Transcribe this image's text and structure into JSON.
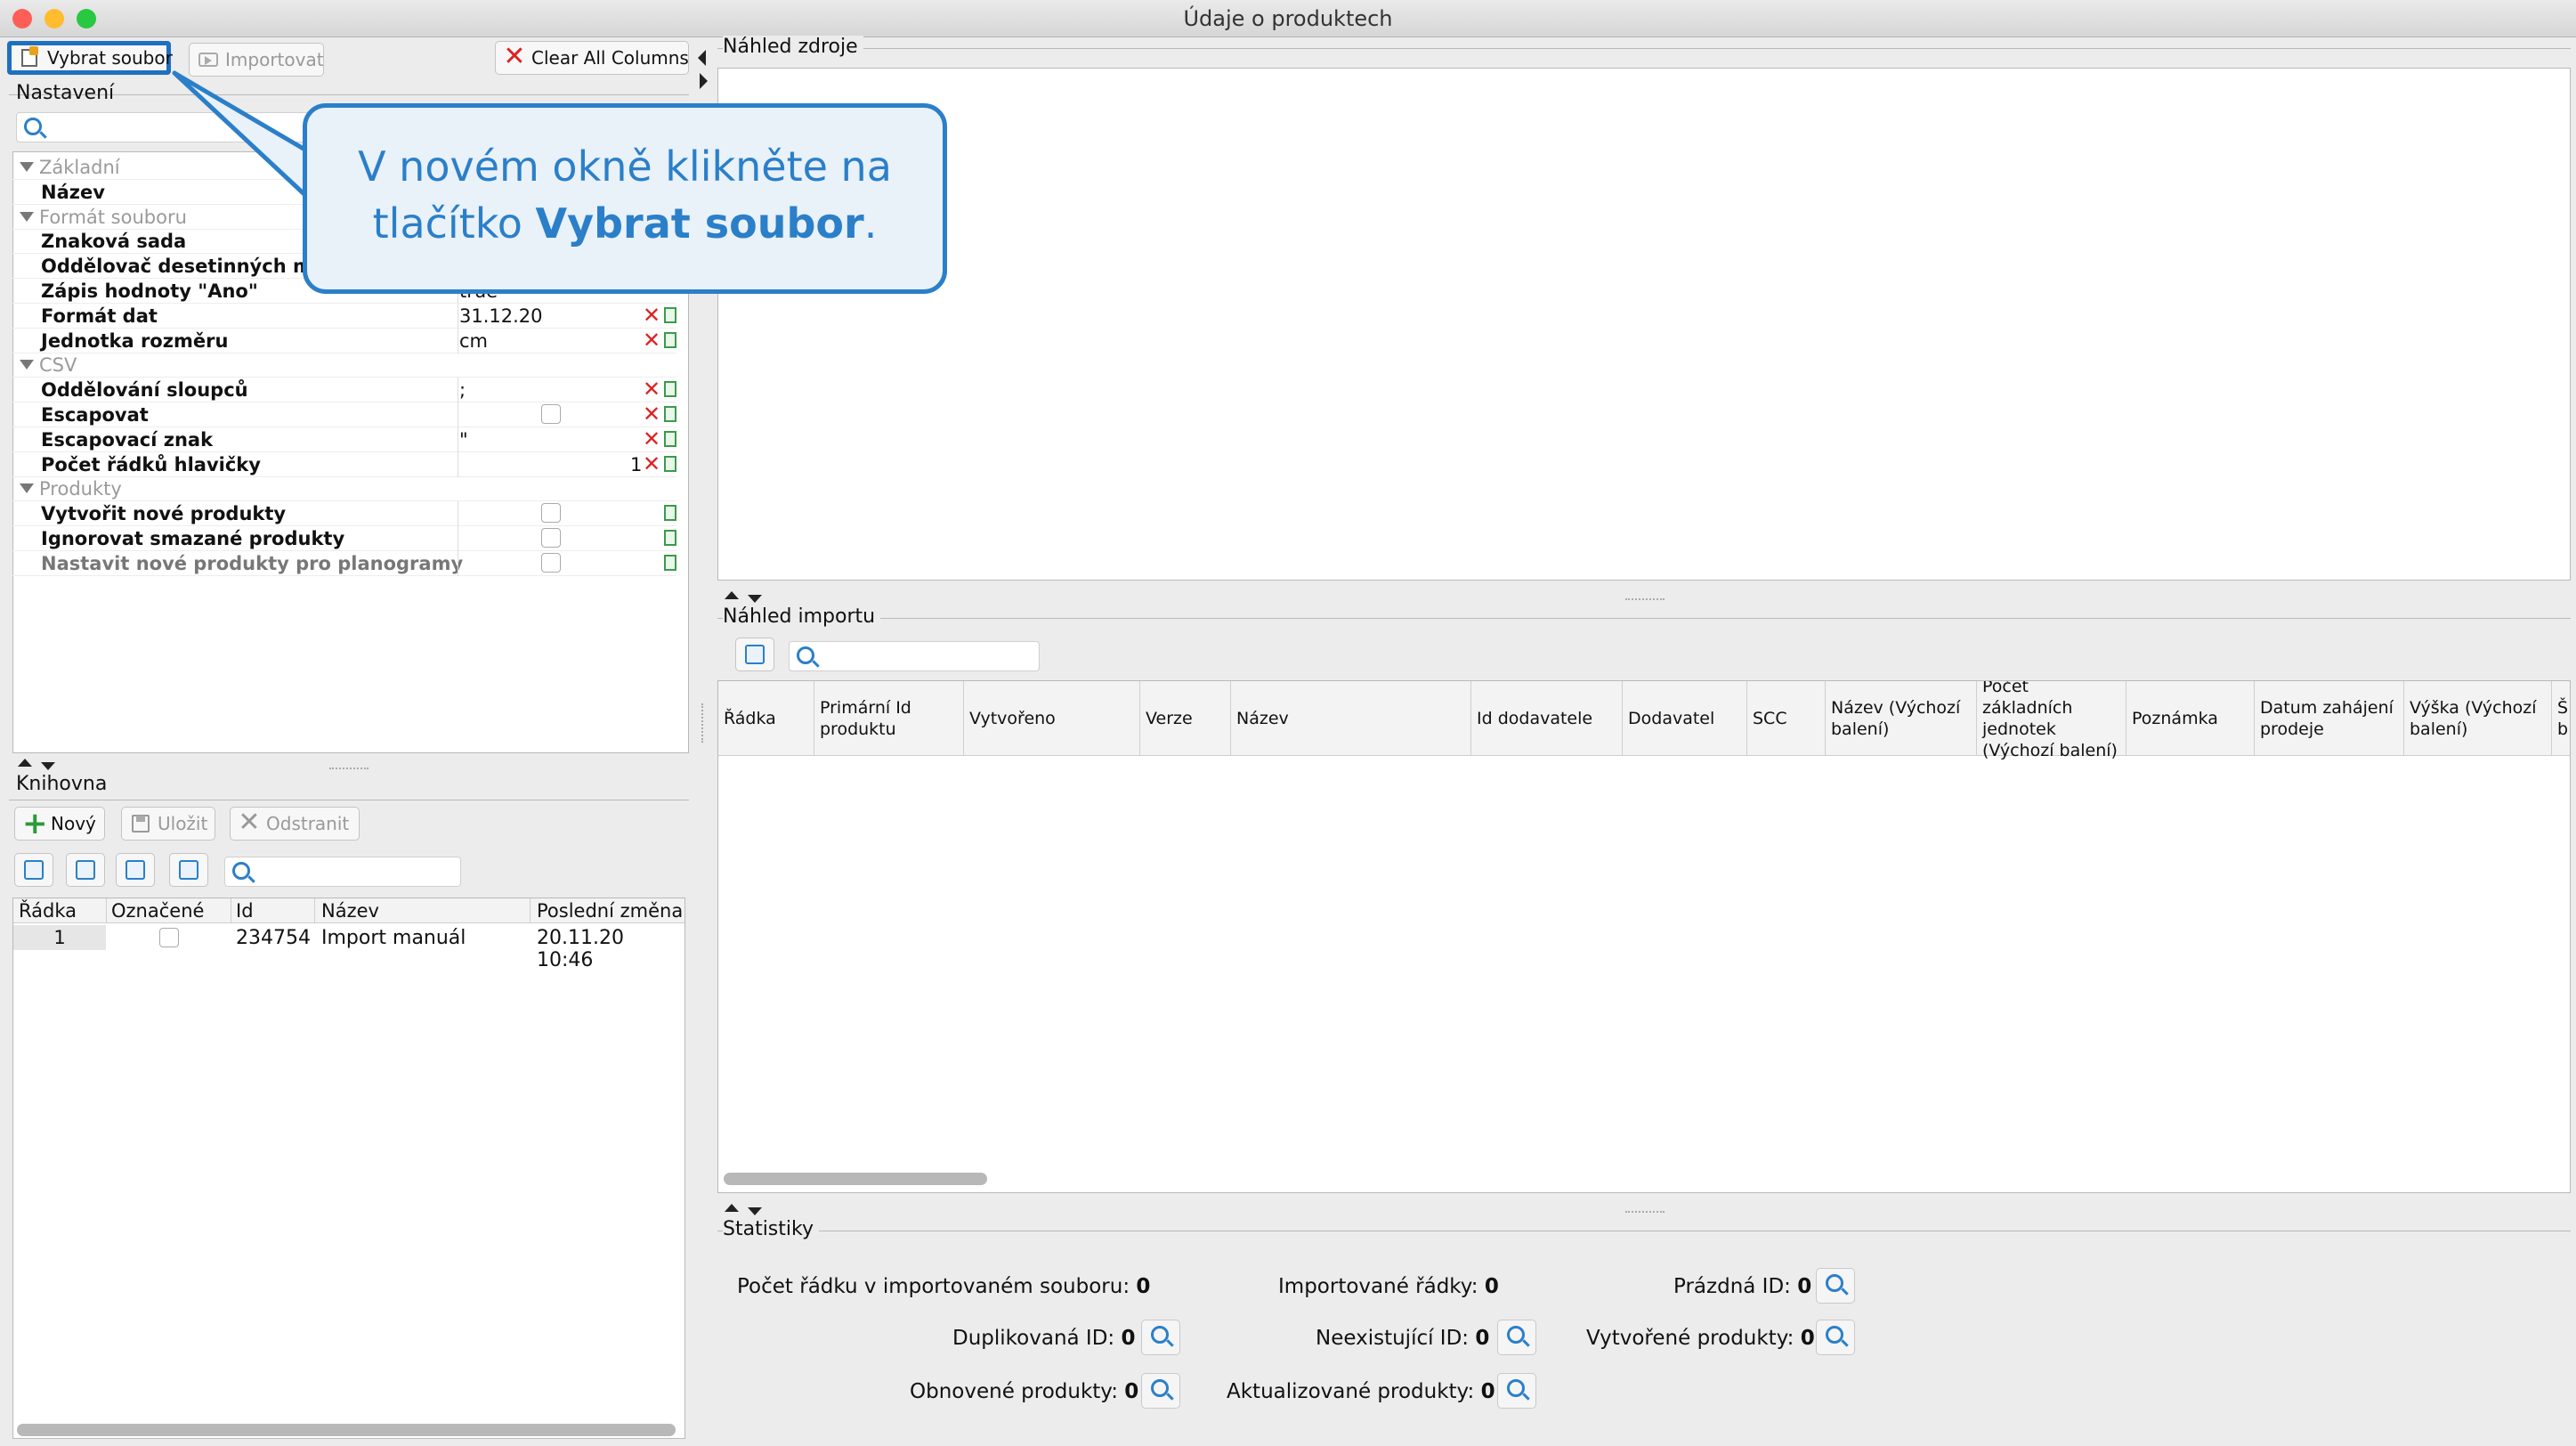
{
  "window": {
    "title": "Údaje o produktech"
  },
  "toolbar": {
    "select_file": "Vybrat soubor",
    "import": "Importovat",
    "clear_all": "Clear All Columns"
  },
  "settings": {
    "label": "Nastavení",
    "rows": [
      {
        "type": "group",
        "label": "Základní"
      },
      {
        "type": "prop",
        "label": "Název",
        "value": ""
      },
      {
        "type": "group",
        "label": "Formát souboru"
      },
      {
        "type": "prop",
        "label": "Znaková sada",
        "value": ""
      },
      {
        "type": "prop",
        "label": "Oddělovač desetinných míst",
        "value": ""
      },
      {
        "type": "prop",
        "label": "Zápis hodnoty \"Ano\"",
        "value": "true"
      },
      {
        "type": "prop",
        "label": "Formát dat",
        "value": "31.12.20"
      },
      {
        "type": "prop",
        "label": "Jednotka rozměru",
        "value": "cm"
      },
      {
        "type": "group",
        "label": "CSV"
      },
      {
        "type": "prop",
        "label": "Oddělování sloupců",
        "value": ";"
      },
      {
        "type": "prop",
        "label": "Escapovat",
        "value": ""
      },
      {
        "type": "prop",
        "label": "Escapovací znak",
        "value": "\""
      },
      {
        "type": "prop",
        "label": "Počet řádků hlavičky",
        "value": "1"
      },
      {
        "type": "group",
        "label": "Produkty"
      },
      {
        "type": "prop",
        "label": "Vytvořit nové produkty",
        "value": ""
      },
      {
        "type": "prop",
        "label": "Ignorovat smazané produkty",
        "value": ""
      },
      {
        "type": "prop",
        "label": "Nastavit nové produkty pro planogramy",
        "value": ""
      }
    ]
  },
  "library": {
    "label": "Knihovna",
    "new": "Nový",
    "save": "Uložit",
    "remove": "Odstranit",
    "columns": [
      "Řádka",
      "Označené",
      "Id",
      "Název",
      "Poslední změna"
    ],
    "rows": [
      {
        "row": "1",
        "id": "234754",
        "name": "Import manuál",
        "changed": "20.11.20 10:46"
      }
    ]
  },
  "source_preview": {
    "label": "Náhled zdroje"
  },
  "import_preview": {
    "label": "Náhled importu",
    "columns": [
      "Řádka",
      "Primární Id produktu",
      "Vytvořeno",
      "Verze",
      "Název",
      "Id dodavatele",
      "Dodavatel",
      "SCC",
      "Název (Výchozí balení)",
      "Počet základních jednotek (Výchozí balení)",
      "Poznámka",
      "Datum zahájení prodeje",
      "Výška (Výchozí balení)",
      "Š b"
    ]
  },
  "stats": {
    "label": "Statistiky",
    "rows_in_file": "Počet řádku v importovaném souboru:",
    "rows_in_file_v": "0",
    "imported_rows": "Importované řádky:",
    "imported_rows_v": "0",
    "empty_id": "Prázdná ID:",
    "empty_id_v": "0",
    "dup_id": "Duplikovaná ID:",
    "dup_id_v": "0",
    "nonexist_id": "Neexistující ID:",
    "nonexist_id_v": "0",
    "created": "Vytvořené produkty:",
    "created_v": "0",
    "restored": "Obnovené produkty:",
    "restored_v": "0",
    "updated": "Aktualizované produkty:",
    "updated_v": "0"
  },
  "callout": {
    "line1": "V novém okně klikněte na",
    "line2_pre": "tlačítko ",
    "line2_bold": "Vybrat soubor",
    "line2_post": "."
  },
  "colors": {
    "accent": "#2b7fc9",
    "highlight": "#1f6fbf"
  }
}
